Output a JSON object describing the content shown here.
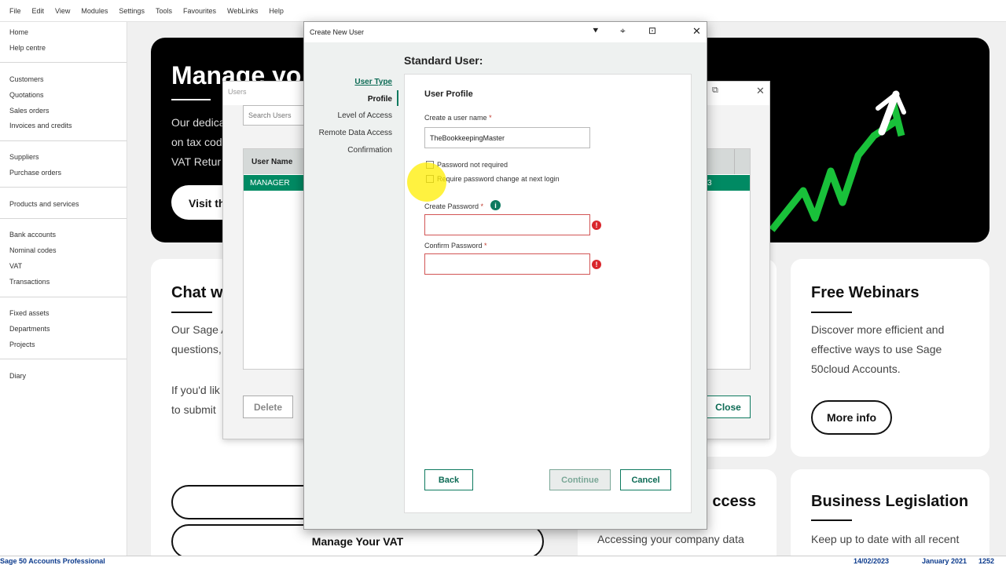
{
  "menu": [
    "File",
    "Edit",
    "View",
    "Modules",
    "Settings",
    "Tools",
    "Favourites",
    "WebLinks",
    "Help"
  ],
  "nav": {
    "items": [
      "Home",
      "Help centre",
      "Customers",
      "Quotations",
      "Sales orders",
      "Invoices and credits",
      "Suppliers",
      "Purchase orders",
      "Products and services",
      "Bank accounts",
      "Nominal codes",
      "VAT",
      "Transactions",
      "Fixed assets",
      "Departments",
      "Projects",
      "Diary"
    ]
  },
  "hero": {
    "title": "Manage yo",
    "lines": [
      "Our dedica",
      "on tax cod",
      "VAT Retur"
    ],
    "button": "Visit th"
  },
  "cards": {
    "chat": {
      "title": "Chat wi",
      "lines": [
        "Our Sage A",
        "questions,",
        "If you'd lik",
        "to submit"
      ],
      "button_vat": "Manage Your VAT"
    },
    "webinars": {
      "title": "Free Webinars",
      "lines": [
        "Discover more efficient and",
        "effective ways to use Sage",
        "50cloud Accounts."
      ],
      "button": "More info"
    },
    "access": {
      "title": "ccess",
      "text": "Accessing your company data"
    },
    "legislation": {
      "title": "Business Legislation",
      "text": "Keep up to date with all recent"
    }
  },
  "users_window": {
    "title": "Users",
    "search_placeholder": "Search Users",
    "column": "User Name",
    "rows": [
      "MANAGER"
    ],
    "row_right_fragment": "3",
    "delete": "Delete",
    "close": "Close"
  },
  "dialog": {
    "title": "Create New User",
    "heading": "Standard User:",
    "steps": [
      "User Type",
      "Profile",
      "Level of Access",
      "Remote Data Access",
      "Confirmation"
    ],
    "section_title": "User Profile",
    "username_label": "Create a user name",
    "username_value": "TheBookkeepingMaster",
    "pw_not_required": "Password not required",
    "require_change": "Require password change at next login",
    "create_pw_label": "Create Password",
    "confirm_pw_label": "Confirm Password",
    "back": "Back",
    "continue": "Continue",
    "cancel": "Cancel",
    "required_mark": "*"
  },
  "status": {
    "product": "Sage 50 Accounts Professional",
    "date": "14/02/2023",
    "period": "January 2021",
    "number": "1252"
  },
  "colors": {
    "accent_green": "#0d7a5f",
    "selected_row": "#008a63",
    "error_red": "#d9262c",
    "chart_green": "#19c13a"
  }
}
